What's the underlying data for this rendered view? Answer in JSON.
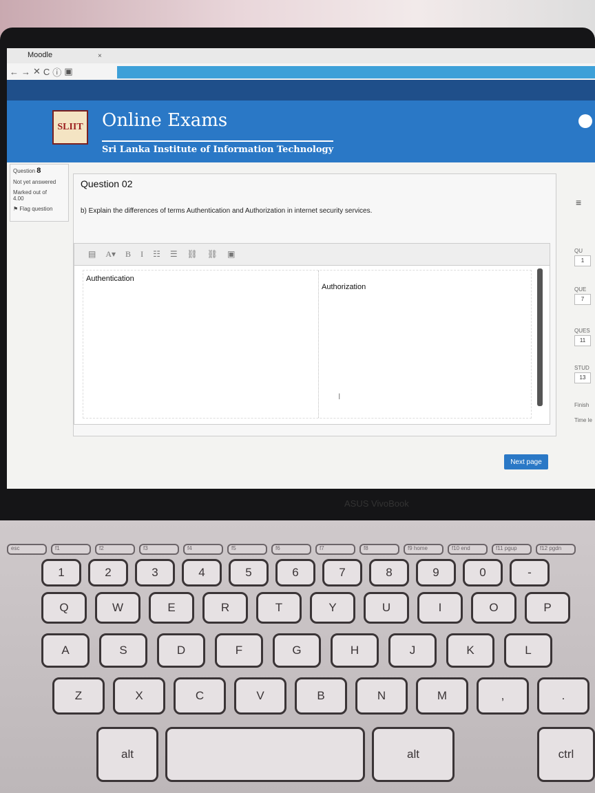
{
  "browser": {
    "tab_title": "Moodle",
    "tab_close": "×",
    "nav_icons": [
      "back-arrow-icon",
      "forward-arrow-icon",
      "stop-icon",
      "reload-icon",
      "info-icon",
      "page-icon"
    ],
    "nav_glyphs": [
      "←",
      "→",
      "✕",
      "C",
      "ⓘ",
      "▣"
    ]
  },
  "header": {
    "logo_text": "SLIIT",
    "title": "Online Exams",
    "subtitle": "Sri Lanka Institute of Information Technology"
  },
  "question_info": {
    "label": "Question",
    "number": "8",
    "status": "Not yet answered",
    "marked_label": "Marked out of",
    "marked_value": "4.00",
    "flag": "Flag question"
  },
  "question": {
    "heading": "Question 02",
    "text": "b) Explain the differences of terms Authentication and Authorization in internet security services."
  },
  "editor": {
    "toolbar": [
      "▤",
      "A▾",
      "B",
      "I",
      "☷",
      "☰",
      "⛓",
      "⛓",
      "▣"
    ],
    "columns": [
      "Authentication",
      "Authorization"
    ],
    "caret": "I"
  },
  "actions": {
    "next_page": "Next page"
  },
  "right_nav": {
    "menu_icon": "≡",
    "items": [
      {
        "label": "QU",
        "num": "1"
      },
      {
        "label": "QUE",
        "num": "7"
      },
      {
        "label": "QUES",
        "num": "11"
      },
      {
        "label": "STUD",
        "num": "13"
      }
    ],
    "finish": "Finish",
    "time": "Time le"
  },
  "laptop": {
    "brand": "ASUS VivoBook",
    "keyboard_rows": [
      [
        "1",
        "2",
        "3",
        "4",
        "5",
        "6",
        "7",
        "8",
        "9",
        "0",
        "-",
        "="
      ],
      [
        "Q",
        "W",
        "E",
        "R",
        "T",
        "Y",
        "U",
        "I",
        "O",
        "P",
        "{"
      ],
      [
        "A",
        "S",
        "D",
        "F",
        "G",
        "H",
        "J",
        "K",
        "L",
        ";"
      ],
      [
        "Z",
        "X",
        "C",
        "V",
        "B",
        "N",
        "M",
        ",",
        "."
      ],
      [
        "alt",
        "alt",
        "ctrl"
      ]
    ],
    "fn_keys": [
      "esc",
      "f1",
      "f2",
      "f3",
      "f4",
      "f5",
      "f6",
      "f7",
      "f8",
      "f9 home",
      "f10 end",
      "f11 pgup",
      "f12 pgdn"
    ]
  }
}
